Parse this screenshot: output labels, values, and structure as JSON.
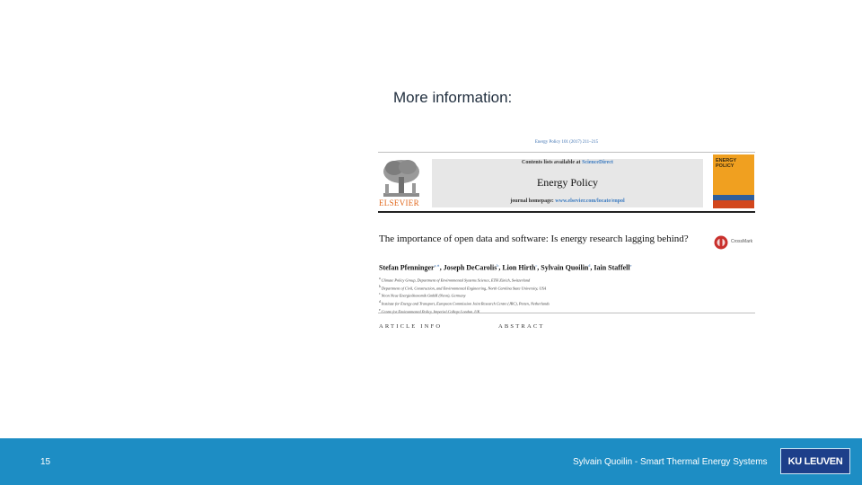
{
  "slide": {
    "heading": "More information:"
  },
  "paper": {
    "citation": "Energy Policy 101 (2017) 211–215",
    "contents_prefix": "Contents lists available at",
    "contents_link": "ScienceDirect",
    "journal_name": "Energy Policy",
    "homepage_prefix": "journal homepage:",
    "homepage_url": "www.elsevier.com/locate/enpol",
    "publisher_logo_text": "ELSEVIER",
    "cover_text": "ENERGY POLICY",
    "crossmark_text": "CrossMark",
    "title": "The importance of open data and software: Is energy research lagging behind?",
    "authors": [
      {
        "name": "Stefan Pfenninger",
        "marks": "a,∗"
      },
      {
        "name": "Joseph DeCarolis",
        "marks": "b"
      },
      {
        "name": "Lion Hirth",
        "marks": "c"
      },
      {
        "name": "Sylvain Quoilin",
        "marks": "d"
      },
      {
        "name": "Iain Staffell",
        "marks": "e"
      }
    ],
    "affiliations": [
      {
        "mark": "a",
        "text": "Climate Policy Group, Department of Environmental Systems Science, ETH Zürich, Switzerland"
      },
      {
        "mark": "b",
        "text": "Department of Civil, Construction, and Environmental Engineering, North Carolina State University, USA"
      },
      {
        "mark": "c",
        "text": "Neon Neue Energieökonomik GmbH (Neon), Germany"
      },
      {
        "mark": "d",
        "text": "Institute for Energy and Transport, European Commission Joint Research Centre (JRC), Petten, Netherlands"
      },
      {
        "mark": "e",
        "text": "Centre for Environmental Policy, Imperial College London, UK"
      }
    ],
    "section_left": "ARTICLE INFO",
    "section_right": "ABSTRACT"
  },
  "footer": {
    "page_number": "15",
    "text": "Sylvain Quoilin - Smart Thermal Energy Systems",
    "logo_text": "KU LEUVEN"
  },
  "colors": {
    "footer_bar": "#1d8dc4",
    "logo_bg": "#1d3f8a",
    "elsevier_orange": "#e0681d",
    "cover_orange": "#f0a020"
  }
}
